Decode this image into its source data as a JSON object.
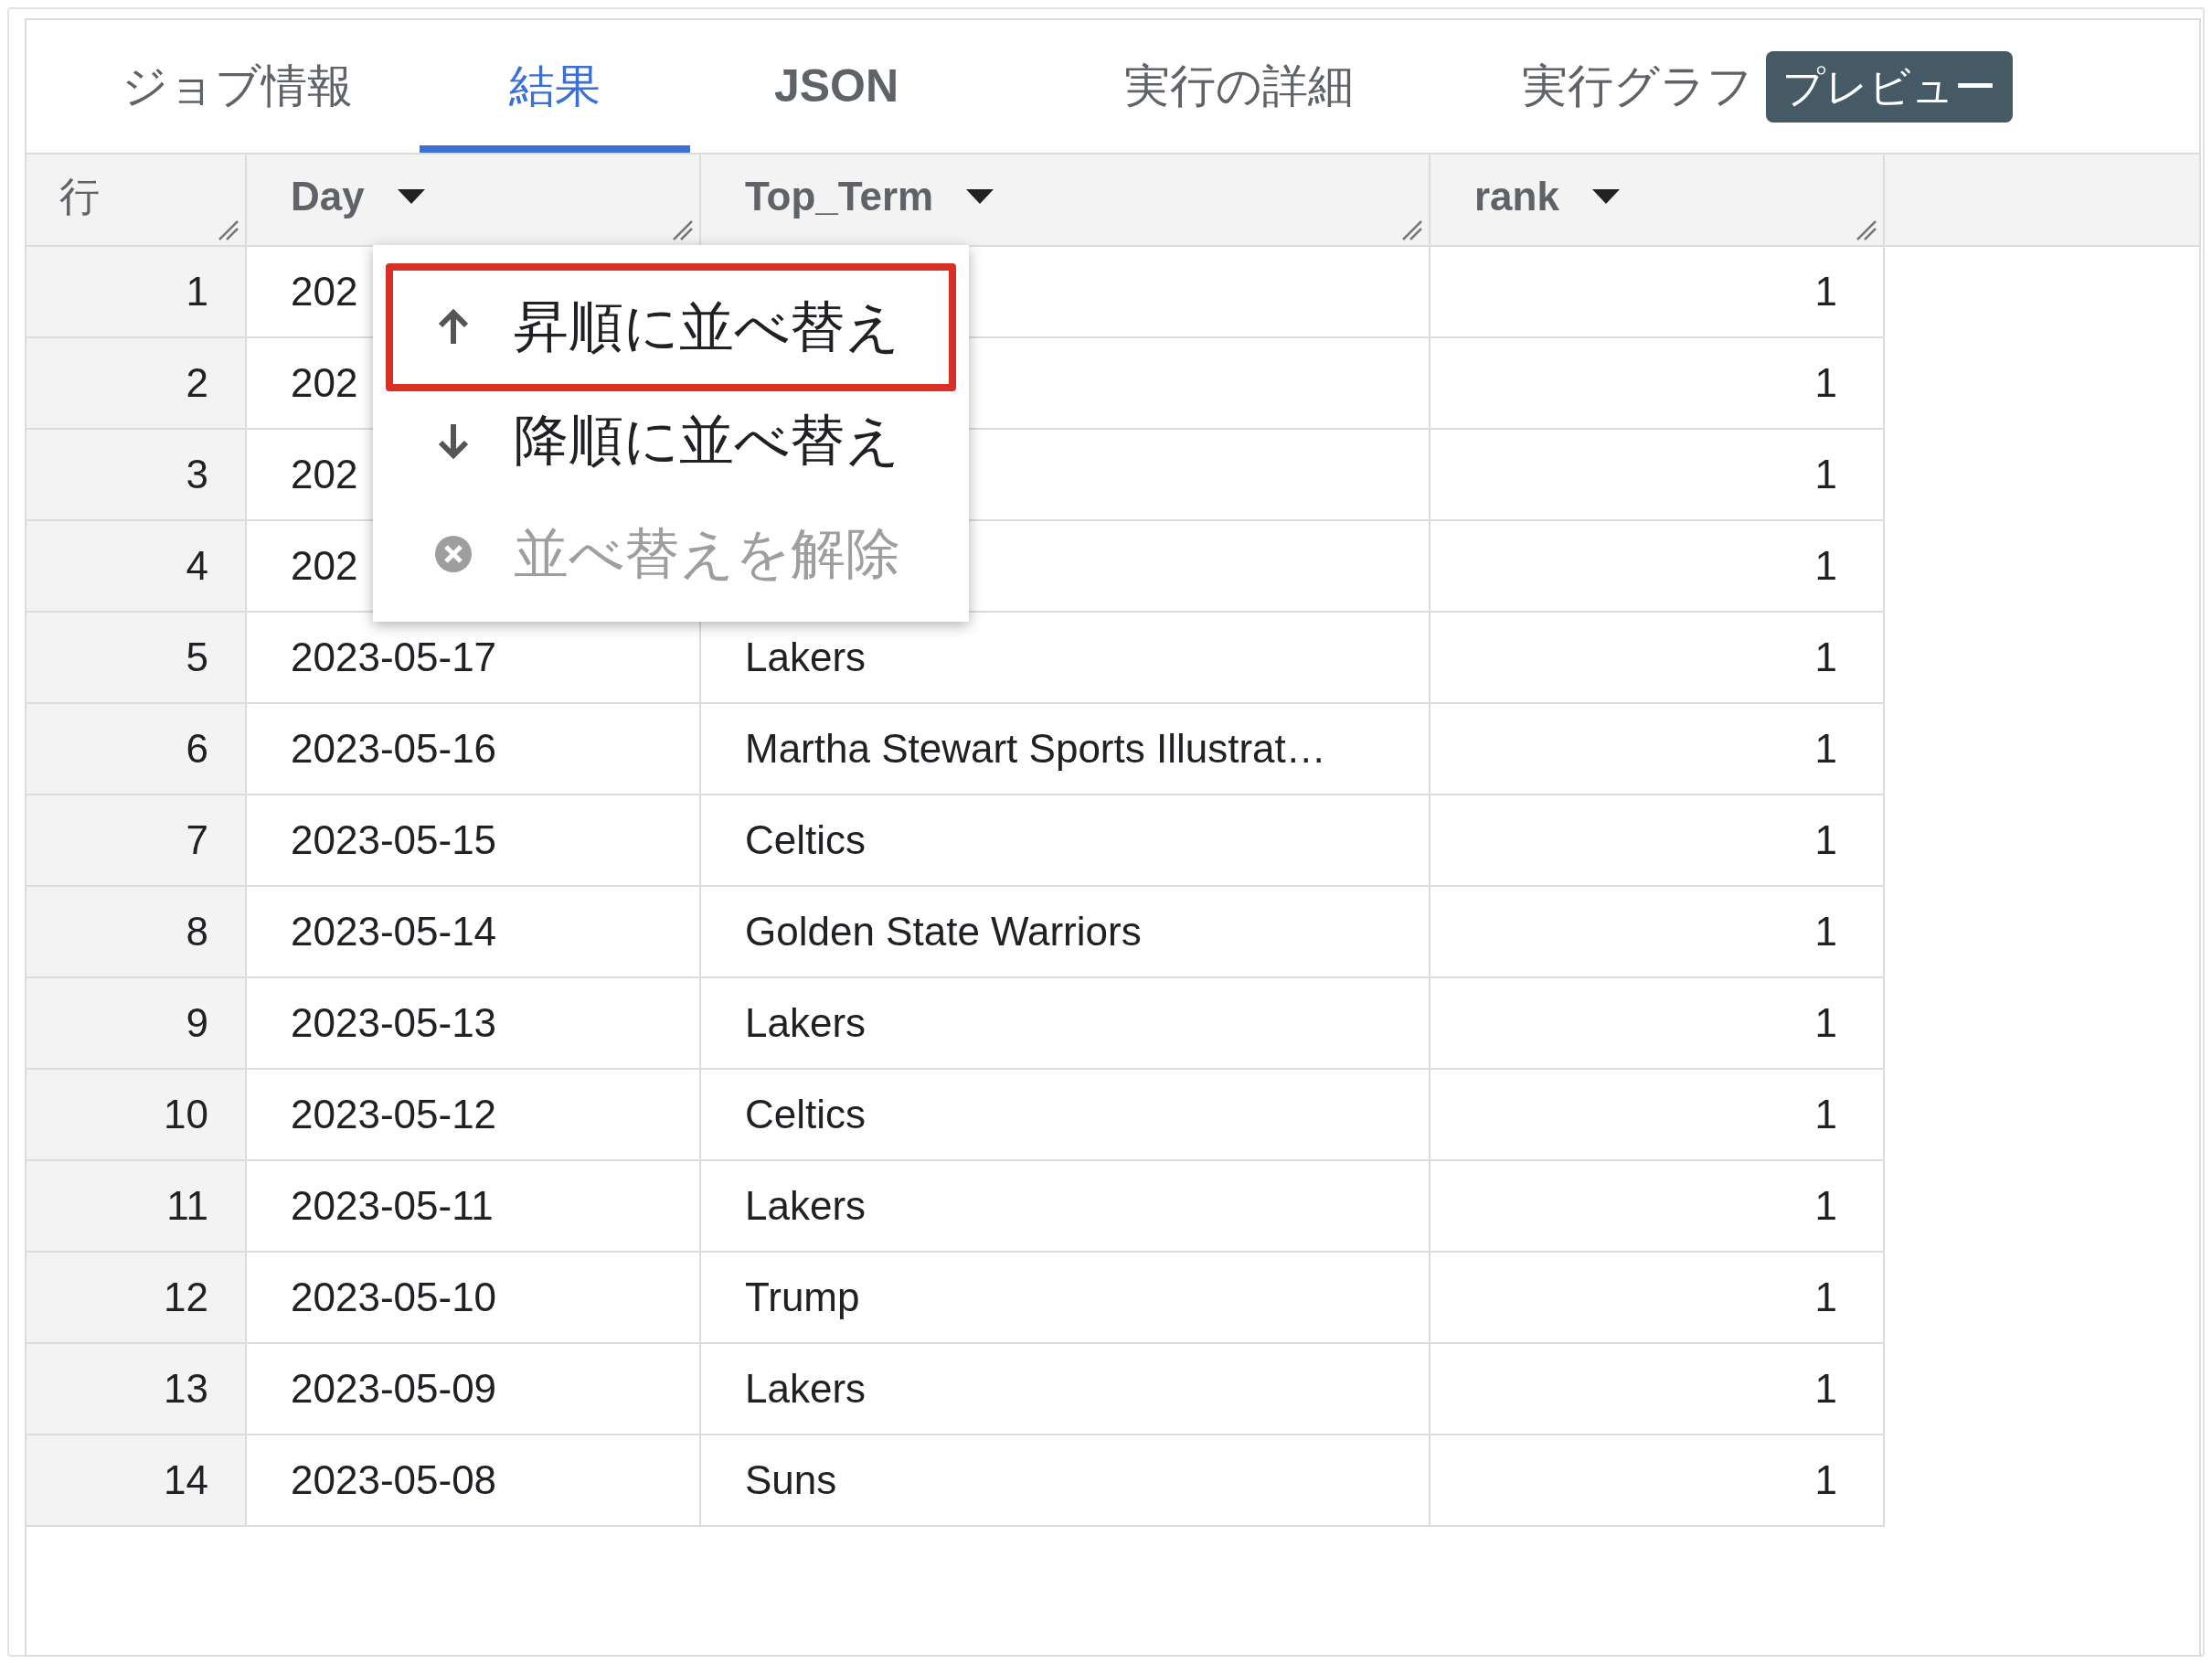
{
  "tabs": [
    {
      "label": "ジョブ情報",
      "selected": false
    },
    {
      "label": "結果",
      "selected": true
    },
    {
      "label": "JSON",
      "selected": false,
      "bold": true
    },
    {
      "label": "実行の詳細",
      "selected": false
    },
    {
      "label": "実行グラフ",
      "selected": false,
      "badge": "プレビュー"
    }
  ],
  "table": {
    "columns": [
      {
        "label": "行",
        "kind": "index"
      },
      {
        "label": "Day",
        "kind": "field"
      },
      {
        "label": "Top_Term",
        "kind": "field"
      },
      {
        "label": "rank",
        "kind": "field"
      }
    ],
    "rows": [
      {
        "index": "1",
        "day": "202",
        "rank": "1"
      },
      {
        "index": "2",
        "day": "202",
        "rank": "1"
      },
      {
        "index": "3",
        "day": "202",
        "rank": "1"
      },
      {
        "index": "4",
        "day": "202",
        "rank": "1"
      },
      {
        "index": "5",
        "day": "2023-05-17",
        "top_term": "Lakers",
        "rank": "1"
      },
      {
        "index": "6",
        "day": "2023-05-16",
        "top_term": "Martha Stewart Sports Illustrat…",
        "rank": "1"
      },
      {
        "index": "7",
        "day": "2023-05-15",
        "top_term": "Celtics",
        "rank": "1"
      },
      {
        "index": "8",
        "day": "2023-05-14",
        "top_term": "Golden State Warriors",
        "rank": "1"
      },
      {
        "index": "9",
        "day": "2023-05-13",
        "top_term": "Lakers",
        "rank": "1"
      },
      {
        "index": "10",
        "day": "2023-05-12",
        "top_term": "Celtics",
        "rank": "1"
      },
      {
        "index": "11",
        "day": "2023-05-11",
        "top_term": "Lakers",
        "rank": "1"
      },
      {
        "index": "12",
        "day": "2023-05-10",
        "top_term": "Trump",
        "rank": "1"
      },
      {
        "index": "13",
        "day": "2023-05-09",
        "top_term": "Lakers",
        "rank": "1"
      },
      {
        "index": "14",
        "day": "2023-05-08",
        "top_term": "Suns",
        "rank": "1"
      }
    ]
  },
  "sort_menu": {
    "items": [
      {
        "label": "昇順に並べ替え",
        "kind": "ascending",
        "selected": true,
        "disabled": false
      },
      {
        "label": "降順に並べ替え",
        "kind": "descending",
        "selected": false,
        "disabled": false
      },
      {
        "label": "並べ替えを解除",
        "kind": "clear",
        "selected": false,
        "disabled": true
      }
    ]
  }
}
